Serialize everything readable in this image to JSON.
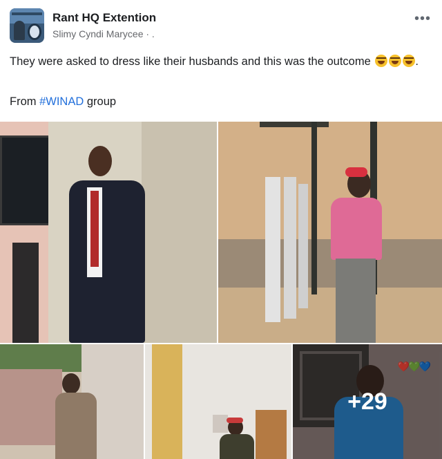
{
  "header": {
    "group_name": "Rant HQ Extention",
    "author": "Slimy Cyndi Marycee · .",
    "more_label": "•••"
  },
  "post": {
    "text": "They were asked to dress like their husbands and this was the outcome",
    "text_end": ".",
    "from_prefix": "From ",
    "hashtag": "#WINAD",
    "from_suffix": " group"
  },
  "photos": {
    "more_count": "+29",
    "hearts": "❤️💚💙"
  },
  "colors": {
    "link": "#216fdb",
    "name": "#1c1e21",
    "meta": "#65676b"
  }
}
